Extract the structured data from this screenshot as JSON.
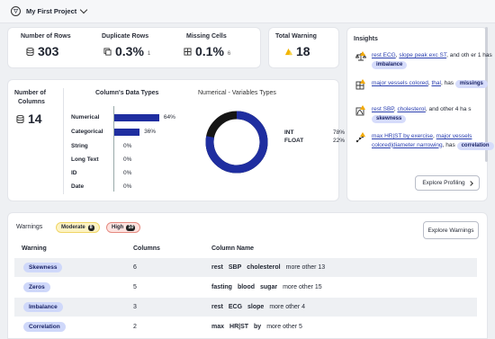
{
  "project": {
    "name": "My First Project"
  },
  "stats": [
    {
      "label": "Number of Rows",
      "value": "303",
      "sub": ""
    },
    {
      "label": "Duplicate Rows",
      "value": "0.3%",
      "sub": "1"
    },
    {
      "label": "Missing Cells",
      "value": "0.1%",
      "sub": "6"
    },
    {
      "label": "Total Warning",
      "value": "18",
      "sub": ""
    }
  ],
  "columns": {
    "label_line1": "Number of",
    "label_line2": "Columns",
    "value": "14"
  },
  "data_types": {
    "title": "Column's Data Types",
    "rows": [
      {
        "label": "Numerical",
        "pct": "64%",
        "value": 64
      },
      {
        "label": "Categorical",
        "pct": "36%",
        "value": 36
      },
      {
        "label": "String",
        "pct": "0%",
        "value": 0
      },
      {
        "label": "Long Text",
        "pct": "0%",
        "value": 0
      },
      {
        "label": "ID",
        "pct": "0%",
        "value": 0
      },
      {
        "label": "Date",
        "pct": "0%",
        "value": 0
      }
    ]
  },
  "num_types": {
    "title": "Numerical - Variables Types",
    "legend": [
      {
        "label": "INT",
        "pct": "78%",
        "value": 78
      },
      {
        "label": "FLOAT",
        "pct": "22%",
        "value": 22
      }
    ],
    "colors": {
      "int": "#1f2ea0",
      "float": "#151515"
    }
  },
  "insights": {
    "title": "Insights",
    "items": [
      {
        "links": [
          "rest ECG",
          "slope peak exc ST"
        ],
        "rest": ", and oth er 1 has",
        "chip": "imbalance",
        "icon": "scale-icon"
      },
      {
        "links": [
          "major vessels colored",
          "thal"
        ],
        "rest": ", has",
        "chip": "missings",
        "icon": "grid-icon"
      },
      {
        "links": [
          "rest SBP",
          "cholesterol"
        ],
        "rest": ", and other 4 ha s",
        "chip": "skewness",
        "icon": "skew-icon"
      },
      {
        "links": [
          "max HR|ST by exercise",
          "major vessels colored|diameter narrowing"
        ],
        "rest": ", has",
        "chip": "correlation",
        "icon": "scatter-icon"
      }
    ],
    "button": "Explore Profiling"
  },
  "warnings": {
    "title": "Warnings",
    "moderate_label": "Moderate",
    "moderate_count": "8",
    "high_label": "High",
    "high_count": "10",
    "button": "Explore Warnings",
    "headers": [
      "Warning",
      "Columns",
      "Column Name"
    ],
    "rows": [
      {
        "type": "Skewness",
        "columns": "6",
        "names": [
          "rest",
          "SBP",
          "cholesterol"
        ],
        "more": "more other 13"
      },
      {
        "type": "Zeros",
        "columns": "5",
        "names": [
          "fasting",
          "blood",
          "sugar"
        ],
        "more": "more other 15"
      },
      {
        "type": "Imbalance",
        "columns": "3",
        "names": [
          "rest",
          "ECG",
          "slope"
        ],
        "more": "more other 4"
      },
      {
        "type": "Correlation",
        "columns": "2",
        "names": [
          "max",
          "HR|ST",
          "by"
        ],
        "more": "more other 5"
      }
    ]
  }
}
